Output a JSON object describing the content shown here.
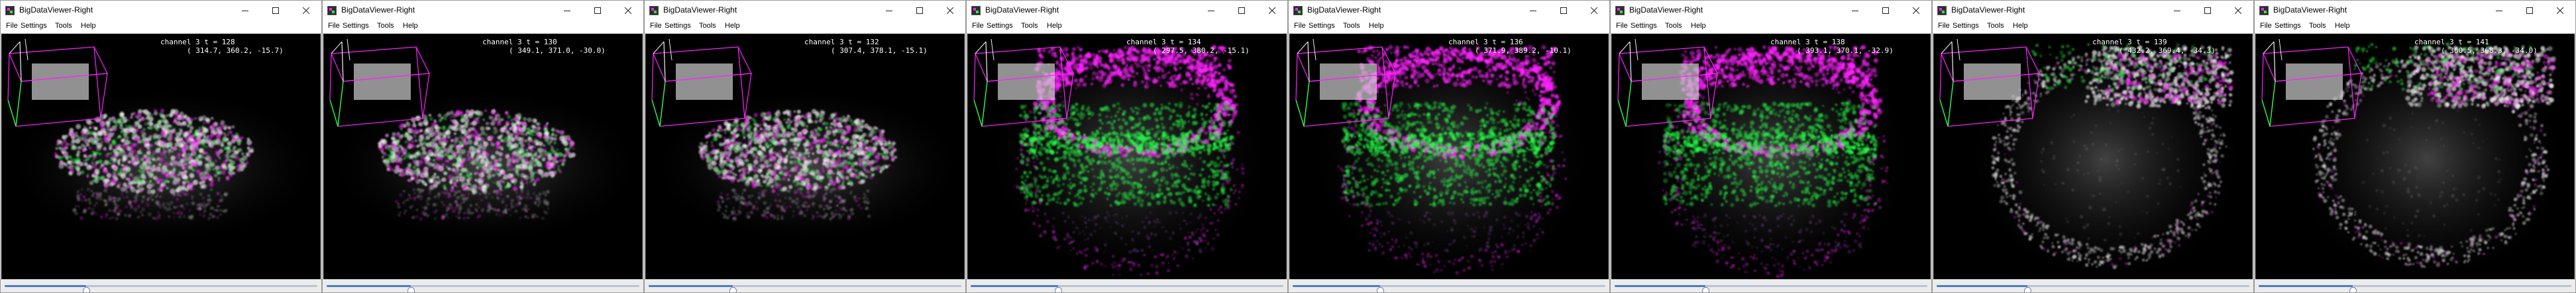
{
  "windows": [
    {
      "title": "BigDataViewer-Right",
      "menu": [
        "File",
        "Settings",
        "Tools",
        "Help"
      ],
      "info_line1": "channel 3 t = 128",
      "info_line2": "( 314.7, 360.2, -15.7)",
      "timepoint_fraction": 0.26,
      "style": "elongated"
    },
    {
      "title": "BigDataViewer-Right",
      "menu": [
        "File",
        "Settings",
        "Tools",
        "Help"
      ],
      "info_line1": "channel 3 t = 130",
      "info_line2": "( 349.1, 371.0, -30.0)",
      "timepoint_fraction": 0.27,
      "style": "elongated"
    },
    {
      "title": "BigDataViewer-Right",
      "menu": [
        "File",
        "Settings",
        "Tools",
        "Help"
      ],
      "info_line1": "channel 3 t = 132",
      "info_line2": "( 307.4, 378.1, -15.1)",
      "timepoint_fraction": 0.27,
      "style": "elongated"
    },
    {
      "title": "BigDataViewer-Right",
      "menu": [
        "File",
        "Settings",
        "Tools",
        "Help"
      ],
      "info_line1": "channel 3 t = 134",
      "info_line2": "( 297.5, 380.2, -15.1)",
      "timepoint_fraction": 0.28,
      "style": "spread"
    },
    {
      "title": "BigDataViewer-Right",
      "menu": [
        "File",
        "Settings",
        "Tools",
        "Help"
      ],
      "info_line1": "channel 3 t = 136",
      "info_line2": "( 371.9, 389.2, -10.1)",
      "timepoint_fraction": 0.28,
      "style": "spread"
    },
    {
      "title": "BigDataViewer-Right",
      "menu": [
        "File",
        "Settings",
        "Tools",
        "Help"
      ],
      "info_line1": "channel 3 t = 138",
      "info_line2": "( 393.1, 370.1, -32.9)",
      "timepoint_fraction": 0.29,
      "style": "spread"
    },
    {
      "title": "BigDataViewer-Right",
      "menu": [
        "File",
        "Settings",
        "Tools",
        "Help"
      ],
      "info_line1": "channel 3 t = 139",
      "info_line2": "( 432.2, 369.4, -34.3)",
      "timepoint_fraction": 0.29,
      "style": "ring"
    },
    {
      "title": "BigDataViewer-Right",
      "menu": [
        "File",
        "Settings",
        "Tools",
        "Help"
      ],
      "info_line1": "channel 3 t = 141",
      "info_line2": "( 360.5, 368.3, -34.0)",
      "timepoint_fraction": 0.3,
      "style": "ring"
    }
  ],
  "colors": {
    "magenta": "#ff22ff",
    "green": "#22ff44",
    "white": "#f4f4f4",
    "slider_track": "#b8c4d6",
    "slider_fill": "#4a7bc8"
  },
  "icons": {
    "app": "bigdataviewer-app-icon",
    "minimize": "minimize-icon",
    "maximize": "maximize-icon",
    "close": "close-icon"
  }
}
